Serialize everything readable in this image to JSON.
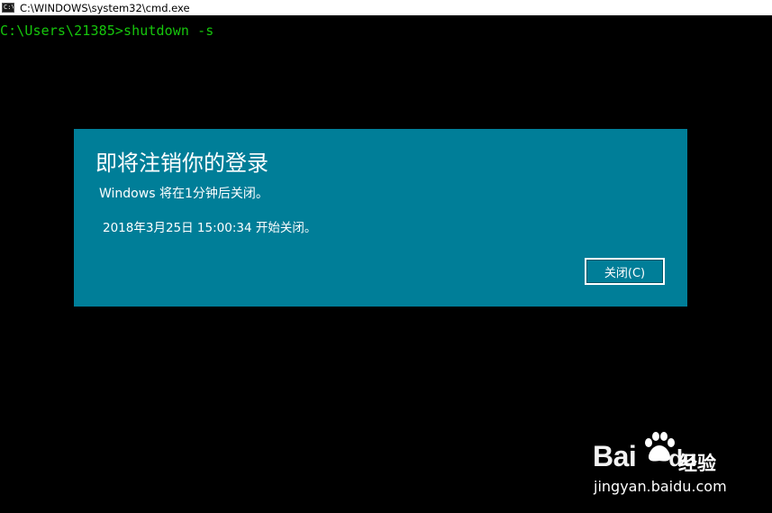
{
  "window": {
    "title": "C:\\WINDOWS\\system32\\cmd.exe",
    "icon": "cmd-icon",
    "icon_glyph": "C:\\"
  },
  "console": {
    "prompt_line": "C:\\Users\\21385>shutdown -s",
    "text_color": "#16c60c",
    "background": "#000000"
  },
  "dialog": {
    "heading": "即将注销你的登录",
    "message": "Windows 将在1分钟后关闭。",
    "shutdown_time": "2018年3月25日 15:00:34 开始关闭。",
    "close_button_label": "关闭(C)",
    "background": "#007e98"
  },
  "watermark": {
    "brand_left": "Bai",
    "brand_right": "du",
    "product": "经验",
    "domain": "jingyan.baidu.com",
    "icon": "baidu-paw-icon"
  }
}
